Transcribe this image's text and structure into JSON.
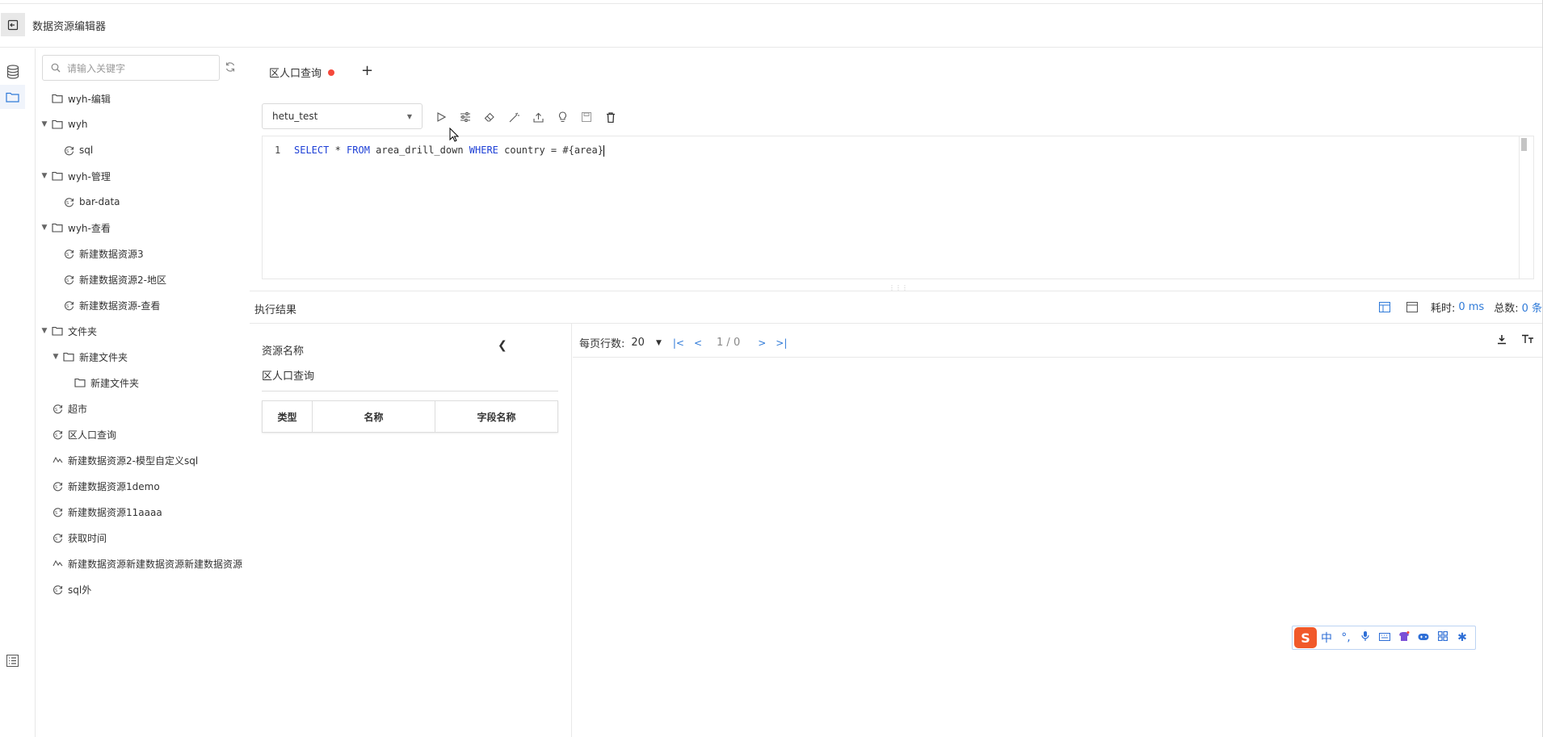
{
  "app": {
    "title": "数据资源编辑器"
  },
  "sidebar": {
    "search_placeholder": "请输入关键字",
    "tree": [
      {
        "label": "wyh-编辑",
        "type": "folder",
        "level": 0,
        "expanded": false
      },
      {
        "label": "wyh",
        "type": "folder",
        "level": 0,
        "expanded": true
      },
      {
        "label": "sql",
        "type": "sql",
        "level": 1
      },
      {
        "label": "wyh-管理",
        "type": "folder",
        "level": 0,
        "expanded": true
      },
      {
        "label": "bar-data",
        "type": "sql",
        "level": 1
      },
      {
        "label": "wyh-查看",
        "type": "folder",
        "level": 0,
        "expanded": true
      },
      {
        "label": "新建数据资源3",
        "type": "sql",
        "level": 1
      },
      {
        "label": "新建数据资源2-地区",
        "type": "sql",
        "level": 1
      },
      {
        "label": "新建数据资源-查看",
        "type": "sql",
        "level": 1
      },
      {
        "label": "文件夹",
        "type": "folder",
        "level": 0,
        "expanded": true
      },
      {
        "label": "新建文件夹",
        "type": "folder",
        "level": 1,
        "expanded": true
      },
      {
        "label": "新建文件夹",
        "type": "folder",
        "level": 2,
        "expanded": false
      },
      {
        "label": "超市",
        "type": "sql",
        "level": 0
      },
      {
        "label": "区人口查询",
        "type": "sql",
        "level": 0
      },
      {
        "label": "新建数据资源2-模型自定义sql",
        "type": "model",
        "level": 0
      },
      {
        "label": "新建数据资源1demo",
        "type": "sql",
        "level": 0
      },
      {
        "label": "新建数据资源11aaaa",
        "type": "sql",
        "level": 0
      },
      {
        "label": "获取时间",
        "type": "sql",
        "level": 0
      },
      {
        "label": "新建数据资源新建数据资源新建数据资源",
        "type": "model",
        "level": 0
      },
      {
        "label": "sql外",
        "type": "sql",
        "level": 0
      }
    ]
  },
  "editor": {
    "tab_label": "区人口查询",
    "tab_add": "+",
    "datasource": "hetu_test",
    "line_number": "1",
    "code": {
      "kw1": "SELECT",
      "t1": " * ",
      "kw2": "FROM",
      "t2": " area_drill_down ",
      "kw3": "WHERE",
      "t3": " country = #{area}"
    }
  },
  "result": {
    "title": "执行结果",
    "elapsed_label": "耗时:",
    "elapsed_value": "0 ms",
    "total_label": "总数:",
    "total_value": "0 条",
    "resource_name_label": "资源名称",
    "resource_name_value": "区人口查询",
    "columns": [
      "类型",
      "名称",
      "字段名称"
    ],
    "page_size_label": "每页行数:",
    "page_size": "20",
    "page_info": "1 / 0"
  },
  "ime": {
    "logo": "S",
    "lang": "中"
  },
  "colors": {
    "accent": "#2f7ad8",
    "unsaved_dot": "#f5483b",
    "keyword": "#1d3fd6"
  }
}
